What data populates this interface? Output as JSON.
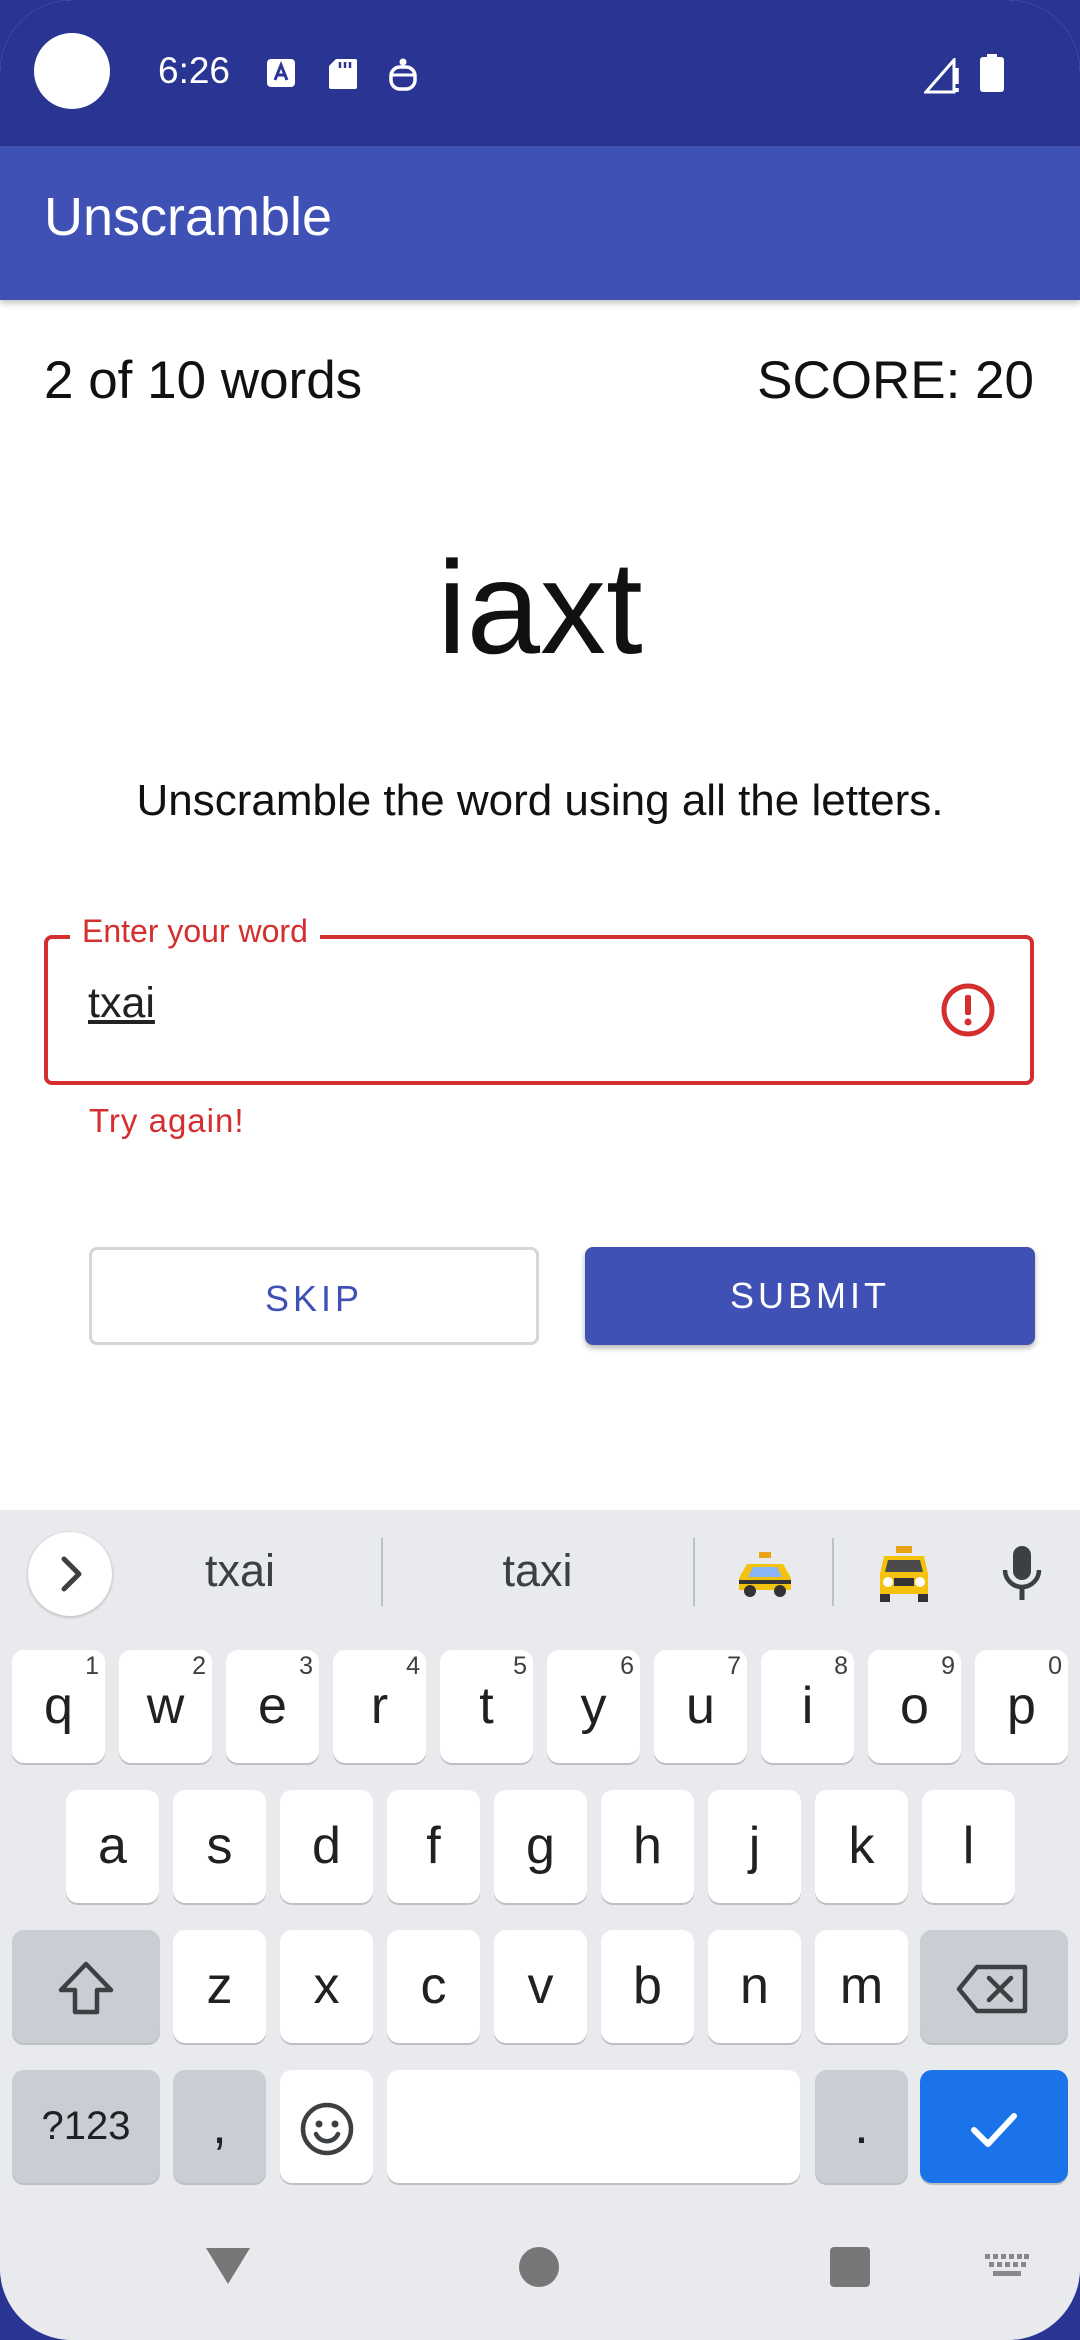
{
  "status_bar": {
    "time": "6:26",
    "icons": [
      "a-notification-icon",
      "sd-card-icon",
      "accessibility-icon",
      "signal-icon",
      "battery-icon"
    ]
  },
  "app_bar": {
    "title": "Unscramble"
  },
  "game": {
    "word_count": "2 of 10 words",
    "score": "SCORE: 20",
    "scrambled_word": "iaxt",
    "instructions": "Unscramble the word using all the letters."
  },
  "input": {
    "label": "Enter your word",
    "value": "txai",
    "helper_text": "Try again!",
    "state": "error"
  },
  "buttons": {
    "skip": "SKIP",
    "submit": "SUBMIT"
  },
  "keyboard": {
    "suggestions": [
      "txai",
      "taxi"
    ],
    "emoji_suggestions": [
      "taxi-emoji",
      "oncoming-taxi-emoji"
    ],
    "row1": [
      {
        "k": "q",
        "h": "1"
      },
      {
        "k": "w",
        "h": "2"
      },
      {
        "k": "e",
        "h": "3"
      },
      {
        "k": "r",
        "h": "4"
      },
      {
        "k": "t",
        "h": "5"
      },
      {
        "k": "y",
        "h": "6"
      },
      {
        "k": "u",
        "h": "7"
      },
      {
        "k": "i",
        "h": "8"
      },
      {
        "k": "o",
        "h": "9"
      },
      {
        "k": "p",
        "h": "0"
      }
    ],
    "row2": [
      "a",
      "s",
      "d",
      "f",
      "g",
      "h",
      "j",
      "k",
      "l"
    ],
    "row3": [
      "z",
      "x",
      "c",
      "v",
      "b",
      "n",
      "m"
    ],
    "symbols_key": "?123",
    "comma_key": ",",
    "period_key": "."
  },
  "colors": {
    "status_bar": "#2a3593",
    "primary": "#3f51b5",
    "error": "#d32f2f",
    "keyboard_bg": "#e8eaed",
    "enter_key": "#1a73e8"
  }
}
